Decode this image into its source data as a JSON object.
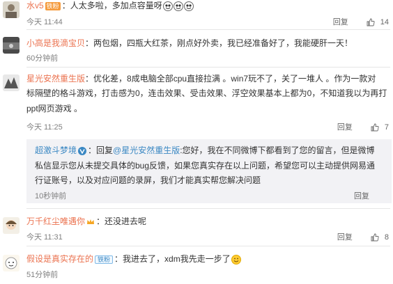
{
  "comments": [
    {
      "username": "水v5",
      "body_lines": [
        "：人太多啦，多加点容量呀"
      ],
      "time": "今天 11:44",
      "reply_label": "回复",
      "likes": "14",
      "badges": [
        "vip-badge",
        "crown-icon"
      ],
      "vip_label": "铁粉"
    },
    {
      "username": "小高是我滴宝贝",
      "body_lines": [
        "：两包烟，四瓶大红茶，刚点好外卖，我已经准备好了，我能硬肝一天！"
      ],
      "time": "60分钟前",
      "reply_label": "回复",
      "likes": ""
    },
    {
      "username": "星光安然重生版",
      "body_lines": [
        "：优化差，8成电脑全部cpu直接拉满 。win7玩不了，关了一堆人 。作为一款对",
        "标隔壁的格斗游戏，打击感为0，连击效果、受击效果、浮空效果基本上都为0，不知道我以为再打",
        "ppt网页游戏 。"
      ],
      "time": "今天 11:25",
      "reply_label": "回复",
      "likes": "7"
    },
    {
      "username": "万千红尘唯遇你",
      "body_lines": [
        "：还没进去呢"
      ],
      "time": "",
      "reply_label": "",
      "likes": ""
    },
    {
      "username": "今天 11:31",
      "body_lines": [],
      "time": "",
      "reply_label": "回复",
      "likes": "8"
    },
    {
      "username": "假设是真实存在的",
      "fan_label": "铁粉",
      "body_lines": [
        "：我进去了，xdm我先走一步了"
      ],
      "time": "51分钟前",
      "reply_label": "回复",
      "likes": ""
    }
  ],
  "reply": {
    "username": "超激斗梦境",
    "reply_word": "：回复",
    "mention": "@星光安然重生版",
    "body_lines": [
      ":您好，我在不同微博下都看到了您的留言，但是微博",
      "私信显示您从未提交具体的bug反馈，如果您真实存在以上问题，希望您可以主动提供网易通",
      "行证账号，以及对应问题的录屏，我们才能真实帮您解决问题"
    ],
    "time": "10秒钟前",
    "reply_label": "回复"
  },
  "colors": {
    "username": "#eb7350",
    "text": "#333333",
    "meta": "#808080",
    "reply_bg": "#f2f2f5"
  }
}
